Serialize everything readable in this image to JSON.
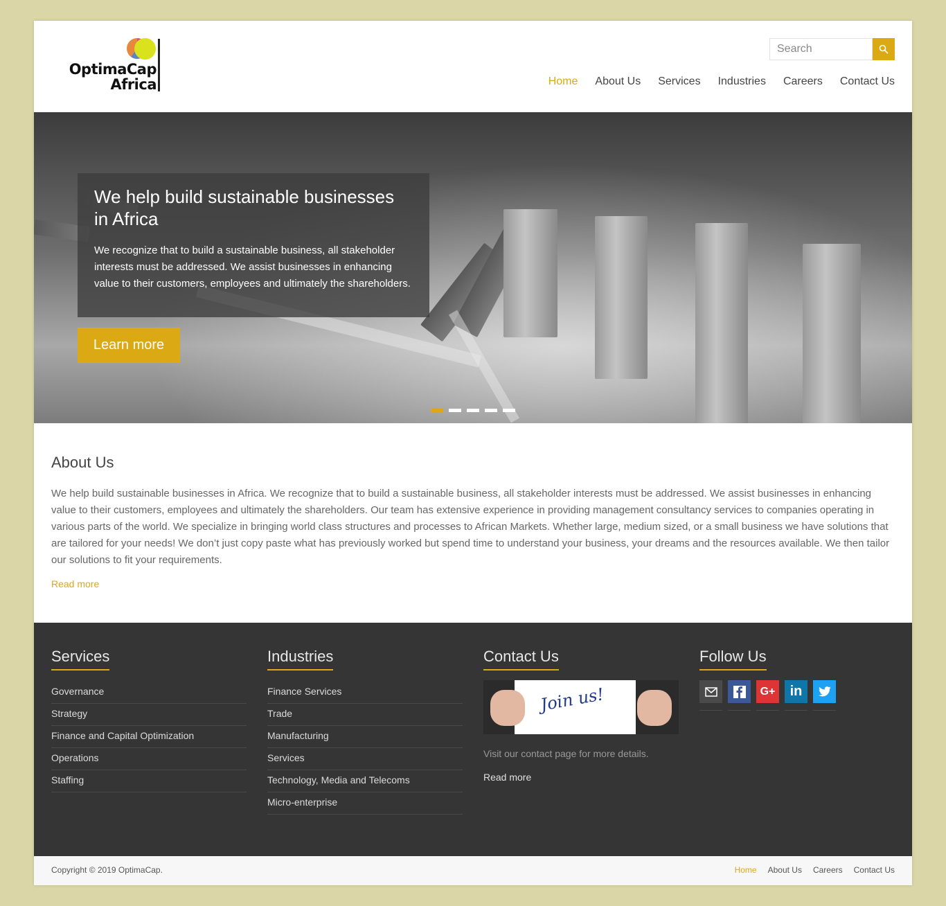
{
  "brand": {
    "line1": "OptimaCap",
    "line2": "Africa"
  },
  "search": {
    "placeholder": "Search"
  },
  "nav": {
    "items": [
      "Home",
      "About Us",
      "Services",
      "Industries",
      "Careers",
      "Contact Us"
    ],
    "active": "Home"
  },
  "hero": {
    "title": "We help build sustainable businesses in Africa",
    "text": "We recognize that to build a sustainable business, all stakeholder interests must be addressed. We assist businesses in enhancing value to their customers, employees and ultimately the shareholders.",
    "button": "Learn more",
    "slides_total": 5,
    "slide_active": 1
  },
  "about": {
    "title": "About Us",
    "text": "We help build sustainable businesses in Africa. We recognize that to build a sustainable business, all stakeholder interests must be addressed. We assist businesses in enhancing value to their customers, employees and ultimately the shareholders. Our team has extensive experience in providing management consultancy services to companies operating in various parts of the world. We specialize in bringing world class structures and processes to African Markets. Whether large, medium sized, or a small business we have solutions that are tailored for your needs! We don’t just copy paste what has previously worked but spend time to understand your business, your dreams and the resources available. We then tailor our solutions to fit your requirements.",
    "read_more": "Read more"
  },
  "footer": {
    "services": {
      "title": "Services",
      "items": [
        "Governance",
        "Strategy",
        "Finance and Capital Optimization",
        "Operations",
        "Staffing"
      ]
    },
    "industries": {
      "title": "Industries",
      "items": [
        "Finance Services",
        "Trade",
        "Manufacturing",
        "Services",
        "Technology, Media and Telecoms",
        "Micro-enterprise"
      ]
    },
    "contact": {
      "title": "Contact Us",
      "image_text": "Join us!",
      "note": "Visit our contact page for more details.",
      "read_more": "Read more"
    },
    "follow": {
      "title": "Follow Us",
      "icons": [
        "email-icon",
        "facebook-icon",
        "google-plus-icon",
        "linkedin-icon",
        "twitter-icon"
      ],
      "colors": {
        "email": "#4a4a4a",
        "facebook": "#3b5998",
        "google_plus": "#dd3535",
        "linkedin": "#0e76a8",
        "twitter": "#1da1f2"
      }
    }
  },
  "bottom": {
    "copyright": "Copyright © 2019 OptimaCap.",
    "links": [
      "Home",
      "About Us",
      "Careers",
      "Contact Us"
    ]
  },
  "colors": {
    "accent": "#dba914",
    "page_bg": "#dad6a8",
    "footer_bg": "#353535"
  }
}
